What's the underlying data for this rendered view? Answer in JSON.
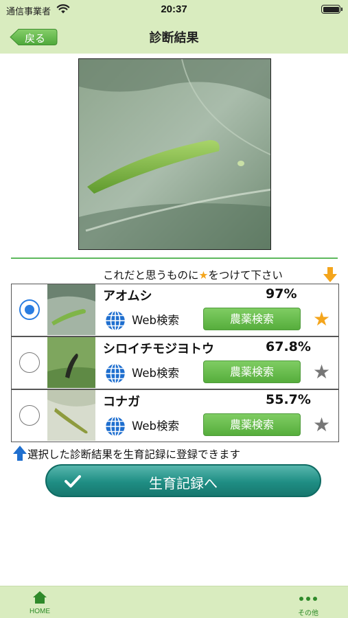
{
  "status_bar": {
    "carrier": "通信事業者",
    "time": "20:37"
  },
  "nav": {
    "back_label": "戻る",
    "title": "診断結果"
  },
  "hint": {
    "before": "これだと思うものに",
    "star": "★",
    "after": "をつけて下さい"
  },
  "results": [
    {
      "name": "アオムシ",
      "percent": "97%",
      "web_label": "Web検索",
      "search_label": "農薬検索",
      "selected": true,
      "favorite": true
    },
    {
      "name": "シロイチモジヨトウ",
      "percent": "67.8%",
      "web_label": "Web検索",
      "search_label": "農薬検索",
      "selected": false,
      "favorite": false
    },
    {
      "name": "コナガ",
      "percent": "55.7%",
      "web_label": "Web検索",
      "search_label": "農薬検索",
      "selected": false,
      "favorite": false
    }
  ],
  "info_text": "選択した診断結果を生育記録に登録できます",
  "cta_label": "生育記録へ",
  "tabs": {
    "home": "HOME",
    "other": "その他"
  },
  "colors": {
    "header_bg": "#d9ecbf",
    "accent_green": "#5cb85c",
    "star_on": "#f4a51c",
    "star_off": "#777777",
    "radio_blue": "#2a7de1",
    "cta_teal": "#1f8e84"
  },
  "icons": [
    "wifi-icon",
    "battery-icon",
    "back-arrow-icon",
    "star-icon",
    "down-arrow-icon",
    "globe-icon",
    "up-arrow-icon",
    "check-icon",
    "home-icon",
    "more-icon"
  ]
}
